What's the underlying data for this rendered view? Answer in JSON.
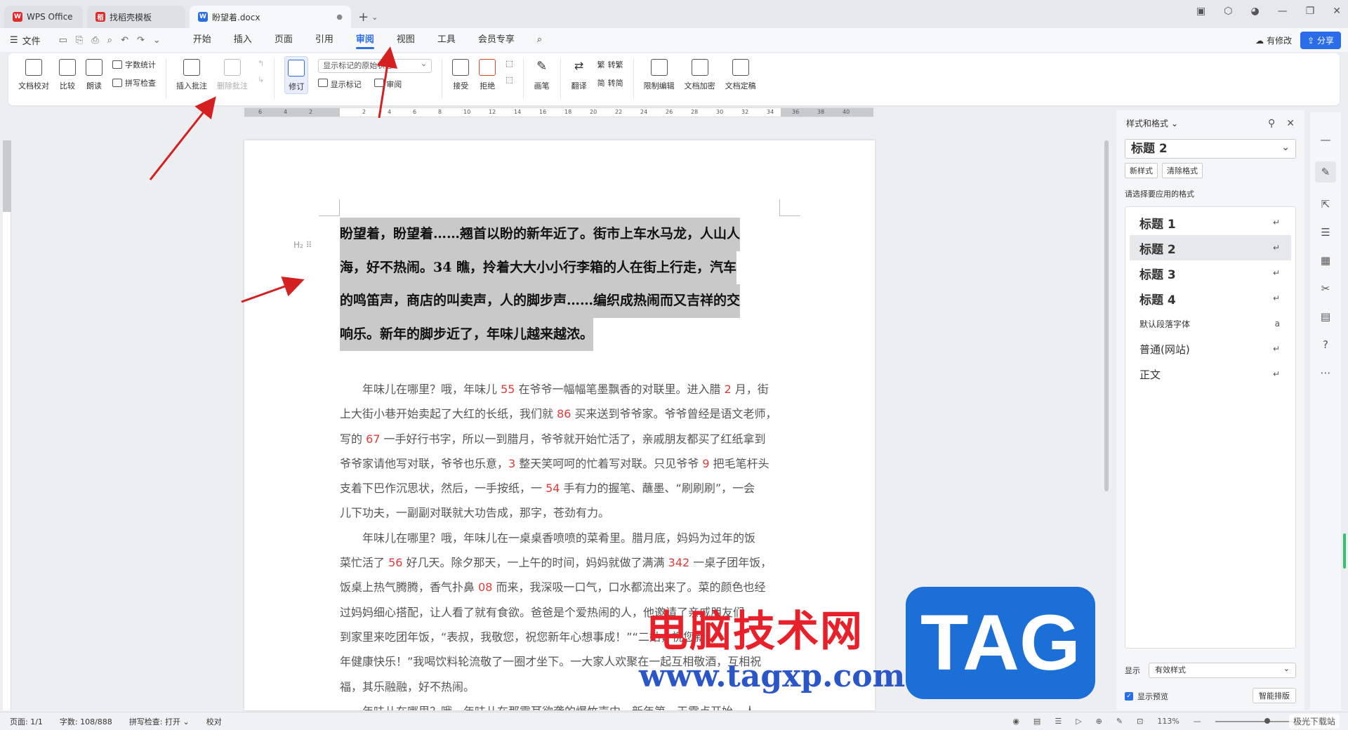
{
  "titlebar": {
    "tabs": [
      {
        "label": "WPS Office",
        "logo": "W",
        "color": "#e02b2b"
      },
      {
        "label": "找稻壳模板",
        "logo": "稻",
        "color": "#e02b2b"
      },
      {
        "label": "盼望着.docx",
        "logo": "W",
        "color": "#2b6de8"
      }
    ],
    "new_tab": "+"
  },
  "menubar": {
    "file_label": "文件",
    "tabs": [
      "开始",
      "插入",
      "页面",
      "引用",
      "审阅",
      "视图",
      "工具",
      "会员专享"
    ],
    "active_tab": "审阅",
    "modify_label": "有修改",
    "share_label": "分享"
  },
  "ribbon": {
    "doc_check": "文档校对",
    "compare": "比较",
    "read_aloud": "朗读",
    "word_count": "字数统计",
    "spell_check": "拼写检查",
    "insert_comment": "插入批注",
    "delete_comment": "删除批注",
    "revise": "修订",
    "display_state": "显示标记的原始状态",
    "show_markup": "显示标记",
    "review": "审阅",
    "accept": "接受",
    "reject": "拒绝",
    "pen": "画笔",
    "translate": "翻译",
    "to_traditional": "转繁",
    "to_simplified": "转简",
    "restrict_edit": "限制编辑",
    "encrypt": "文档加密",
    "finalize": "文档定稿"
  },
  "ruler": {
    "left_nums": [
      "6",
      "4",
      "2"
    ],
    "nums": [
      "2",
      "4",
      "6",
      "8",
      "10",
      "12",
      "14",
      "16",
      "18",
      "20",
      "22",
      "24",
      "26",
      "28",
      "30",
      "32",
      "34",
      "36",
      "38",
      "40"
    ]
  },
  "document": {
    "heading_marker": "H₂ ⠿",
    "heading_lines": [
      "盼望着，盼望着……翘首以盼的新年近了。街市上车水马龙，人山人",
      "海，好不热闹。34 瞧，拎着大大小小行李箱的人在街上行走，汽车",
      "的鸣笛声，商店的叫卖声，人的脚步声……编织成热闹而又吉祥的交",
      "响乐。新年的脚步近了，年味儿越来越浓。"
    ],
    "body_lines": [
      [
        {
          "t": "　　年味儿在哪里？哦，年味儿 "
        },
        {
          "n": "55"
        },
        {
          "t": " 在爷爷一幅幅笔墨飘香的对联里。进入腊 "
        },
        {
          "n": "2"
        },
        {
          "t": " 月，街"
        }
      ],
      [
        {
          "t": "上大街小巷开始卖起了大红的长纸，我们就 "
        },
        {
          "n": "86"
        },
        {
          "t": " 买来送到爷爷家。爷爷曾经是语文老师，"
        }
      ],
      [
        {
          "t": "写的 "
        },
        {
          "n": "67"
        },
        {
          "t": " 一手好行书字，所以一到腊月，爷爷就开始忙活了，亲戚朋友都买了红纸拿到"
        }
      ],
      [
        {
          "t": "爷爷家请他写对联，爷爷也乐意，"
        },
        {
          "n": "3"
        },
        {
          "t": " 整天笑呵呵的忙着写对联。只见爷爷 "
        },
        {
          "n": "9"
        },
        {
          "t": " 把毛笔杆头"
        }
      ],
      [
        {
          "t": "支着下巴作沉思状，然后，一手按纸，一 "
        },
        {
          "n": "54"
        },
        {
          "t": " 手有力的握笔、蘸墨、“刷刷刷”，一会"
        }
      ],
      [
        {
          "t": "儿下功夫，一副副对联就大功告成，那字，苍劲有力。"
        }
      ],
      [
        {
          "t": "　　年味儿在哪里？哦，年味儿在一桌桌香喷喷的菜肴里。腊月底，妈妈为过年的饭"
        }
      ],
      [
        {
          "t": "菜忙活了 "
        },
        {
          "n": "56"
        },
        {
          "t": " 好几天。除夕那天，一上午的时间，妈妈就做了满满 "
        },
        {
          "n": "342"
        },
        {
          "t": " 一桌子团年饭，"
        }
      ],
      [
        {
          "t": "饭桌上热气腾腾，香气扑鼻 "
        },
        {
          "n": "08"
        },
        {
          "t": " 而来，我深吸一口气，口水都流出来了。菜的颜色也经"
        }
      ],
      [
        {
          "t": "过妈妈细心搭配，让人看了就有食欲。爸爸是个爱热闹的人，他邀请了亲戚朋友们"
        }
      ],
      [
        {
          "t": "到家里来吃团年饭，“表叔，我敬您，祝您新年心想事成！”“二姑，祝您新"
        }
      ],
      [
        {
          "t": "年健康快乐！”我喝饮料轮流敬了一圈才坐下。一大家人欢聚在一起互相敬酒，互相祝"
        }
      ],
      [
        {
          "t": "福，其乐融融，好不热闹。"
        }
      ],
      [
        {
          "t": "　　年味儿在哪里？哦，年味儿在那震耳欲聋的爆竹声中。新年第一天零点开始，人"
        }
      ]
    ]
  },
  "pane": {
    "title": "样式和格式",
    "current_style": "标题  2",
    "new_style": "新样式",
    "clear_format": "清除格式",
    "apply_label": "请选择要应用的格式",
    "styles": [
      {
        "label": "标题  1",
        "mark": "↵",
        "kind": "bold"
      },
      {
        "label": "标题  2",
        "mark": "↵",
        "kind": "bold"
      },
      {
        "label": "标题  3",
        "mark": "↵",
        "kind": "bold"
      },
      {
        "label": "标题  4",
        "mark": "↵",
        "kind": "bold"
      },
      {
        "label": "默认段落字体",
        "mark": "a",
        "kind": "small"
      },
      {
        "label": "普通(网站)",
        "mark": "↵",
        "kind": "med"
      },
      {
        "label": "正文",
        "mark": "↵",
        "kind": "med"
      }
    ],
    "selected_style": "标题  2",
    "show_label": "显示",
    "show_value": "有效样式",
    "preview_label": "显示预览",
    "smart_layout": "智能排版"
  },
  "statusbar": {
    "page": "页面: 1/1",
    "words": "字数: 108/888",
    "spell": "拼写检查: 打开",
    "proofread": "校对",
    "zoom": "113%"
  },
  "watermark": {
    "cn": "电脑技术网",
    "url": "www.tagxp.com",
    "tag": "TAG",
    "corner": "极光下载站"
  },
  "colors": {
    "accent": "#2b6de8",
    "number_red": "#e03a3a",
    "arrow": "#d42020",
    "highlight": "#c9c9c9"
  }
}
